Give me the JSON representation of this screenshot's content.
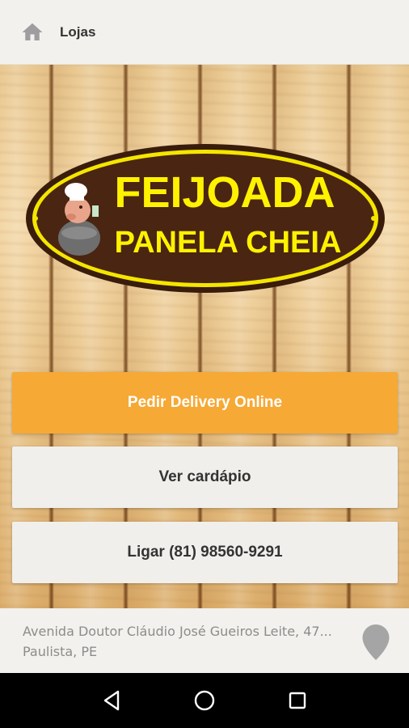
{
  "appbar": {
    "title": "Lojas",
    "home_icon": "home-icon"
  },
  "logo": {
    "line1": "FEIJOADA",
    "line2": "PANELA CHEIA"
  },
  "actions": {
    "delivery_label": "Pedir Delivery Online",
    "menu_label": "Ver cardápio",
    "call_label": "Ligar (81) 98560-9291"
  },
  "address": {
    "line1": "Avenida Doutor Cláudio José Gueiros Leite, 47...",
    "line2": "Paulista, PE",
    "icon": "location-pin-icon"
  },
  "navbar": {
    "back_icon": "back-triangle-icon",
    "home_icon": "home-circle-icon",
    "recents_icon": "recents-square-icon"
  },
  "colors": {
    "primary": "#f6a935",
    "logo_yellow": "#fff200",
    "logo_brown": "#4a2512"
  }
}
